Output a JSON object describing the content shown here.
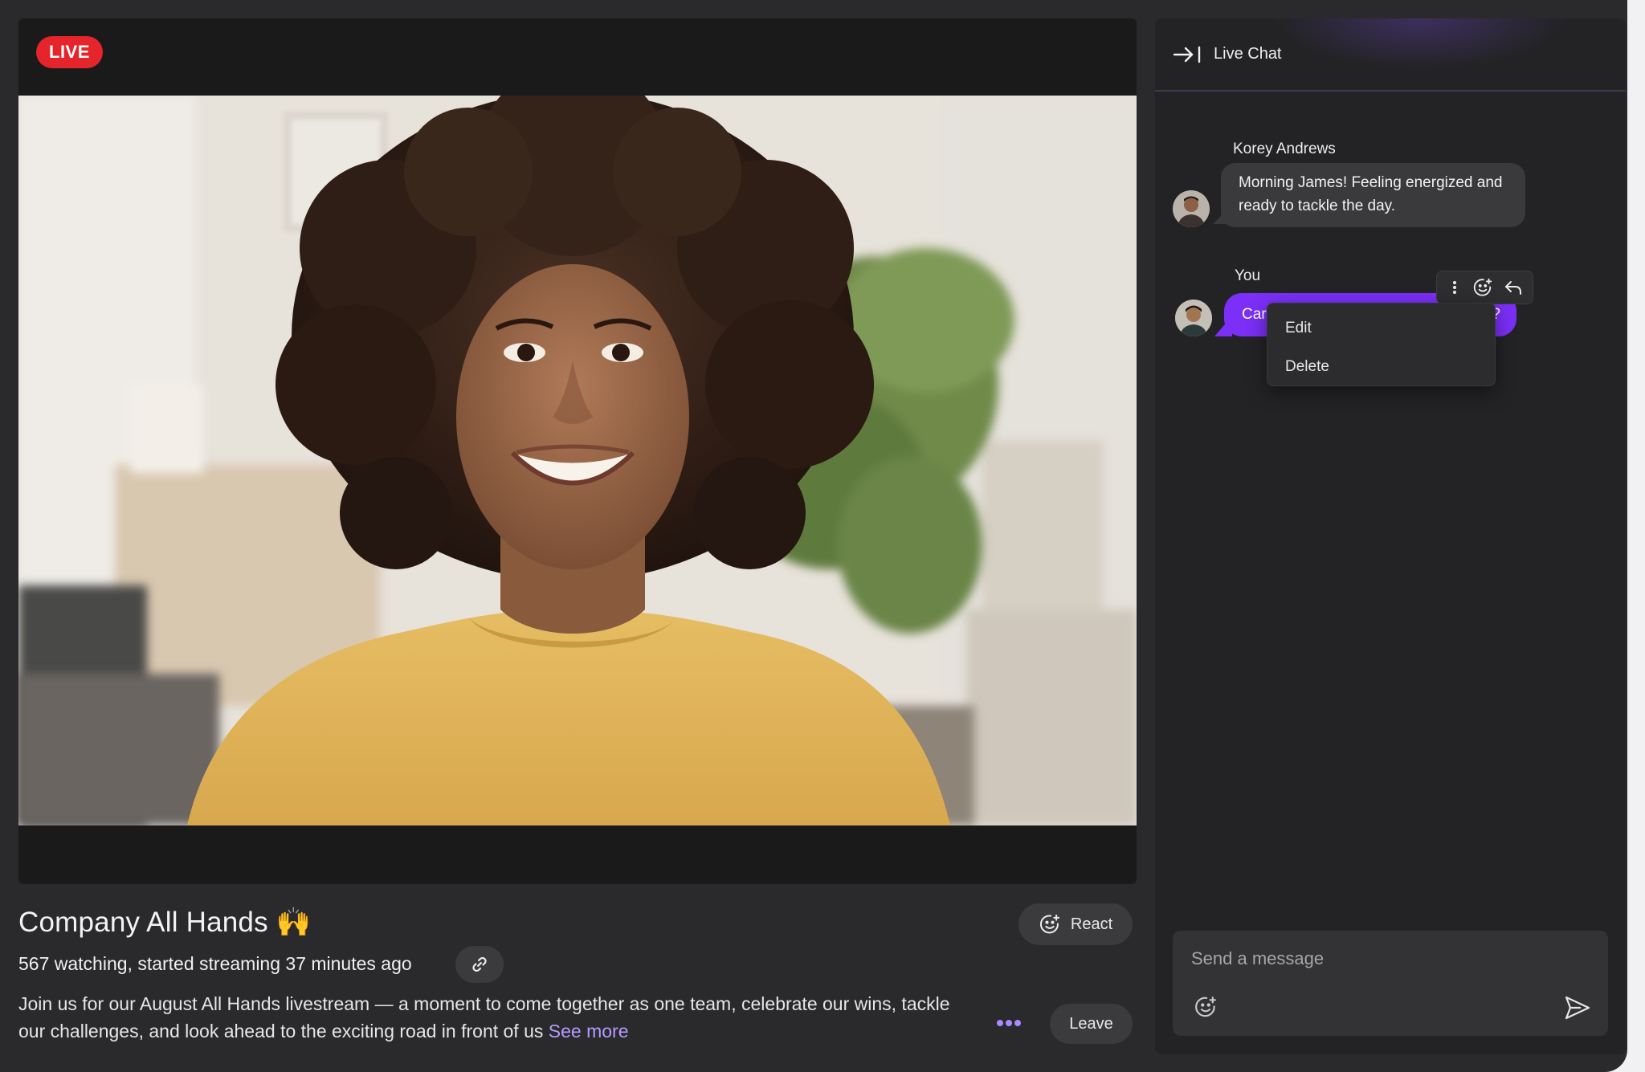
{
  "stream": {
    "live_label": "LIVE",
    "title": "Company All Hands",
    "title_emoji": "🙌",
    "stats": "567 watching, started streaming 37 minutes ago",
    "description": "Join us for our August All Hands livestream — a moment to come together as one team, celebrate our wins, tackle our challenges, and look ahead to the exciting road in front of us",
    "see_more_label": "See more",
    "react_label": "React",
    "leave_label": "Leave"
  },
  "chat": {
    "title": "Live Chat",
    "messages": [
      {
        "sender": "Korey Andrews",
        "text": "Morning James! Feeling energized and ready to tackle the day."
      },
      {
        "sender": "You",
        "text_visible_start": "Car",
        "text_visible_end": "?"
      }
    ],
    "context_menu": {
      "edit_label": "Edit",
      "delete_label": "Delete"
    },
    "composer": {
      "placeholder": "Send a message"
    }
  },
  "colors": {
    "accent": "#7b2ff7",
    "live": "#e5242b",
    "link": "#b49bff",
    "background": "#2a2a2c",
    "panel": "#232325"
  },
  "icons": [
    "collapse-panel-icon",
    "more-vertical-icon",
    "add-reaction-icon",
    "reply-icon",
    "link-icon",
    "more-horizontal-icon",
    "send-icon"
  ]
}
